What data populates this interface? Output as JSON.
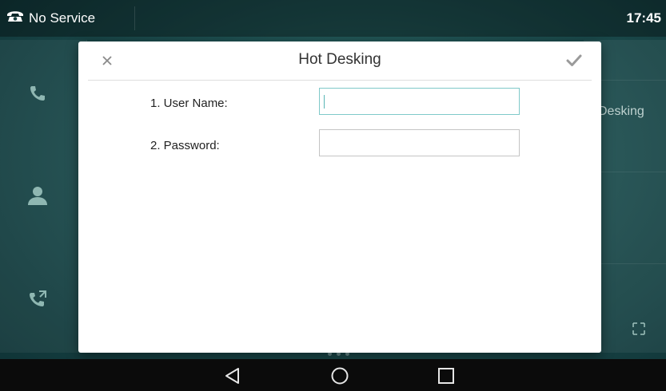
{
  "status_bar": {
    "service_text": "No Service",
    "time": "17:45",
    "icons": {
      "phone": "telephone-icon"
    }
  },
  "background": {
    "right_label": "Desking",
    "left_icons": [
      "handset-icon",
      "contact-icon",
      "call-forward-icon"
    ],
    "corner_icon": "expand-icon"
  },
  "dialog": {
    "title": "Hot Desking",
    "close_icon": "close-icon",
    "confirm_icon": "checkmark-icon",
    "fields": [
      {
        "label": "1. User Name:",
        "value": "",
        "focused": true
      },
      {
        "label": "2. Password:",
        "value": "",
        "focused": false
      }
    ]
  },
  "nav_bar": {
    "buttons": [
      "back-icon",
      "home-icon",
      "recent-apps-icon"
    ]
  },
  "colors": {
    "accent": "#59b6b6",
    "background": "#1d4e4f",
    "dialog": "#ffffff"
  }
}
